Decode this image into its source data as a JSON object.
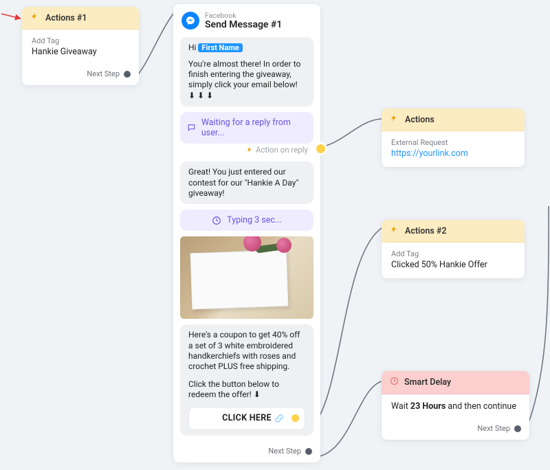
{
  "actions1": {
    "title": "Actions #1",
    "body_label": "Add Tag",
    "body_value": "Hankie Giveaway",
    "next": "Next Step"
  },
  "send": {
    "platform": "Facebook",
    "title": "Send Message #1",
    "greeting_prefix": "Hi ",
    "name_pill": "First Name",
    "msg1_line1": "You're almost there! In order to finish entering the giveaway, simply click your email below! ⬇ ⬇ ⬇",
    "wait": "Waiting for a reply from user...",
    "action_on_reply": "Action on reply",
    "msg2": "Great! You just entered our contest for our \"Hankie A Day\" giveaway!",
    "typing": "Typing 3 sec...",
    "coupon": "Here's a coupon to get 40% off a set of 3 white embroidered handkerchiefs with roses and crochet PLUS free shipping.",
    "coupon2": "Click the button below to redeem the offer! ⬇",
    "cta": "CLICK HERE",
    "next": "Next Step"
  },
  "actions_ext": {
    "title": "Actions",
    "label": "External Request",
    "url": "https://yourlink.com"
  },
  "actions2": {
    "title": "Actions #2",
    "body_label": "Add Tag",
    "body_value": "Clicked 50% Hankie Offer"
  },
  "delay": {
    "title": "Smart Delay",
    "text_prefix": "Wait ",
    "duration": "23 Hours",
    "text_suffix": " and then continue",
    "next": "Next Step"
  }
}
